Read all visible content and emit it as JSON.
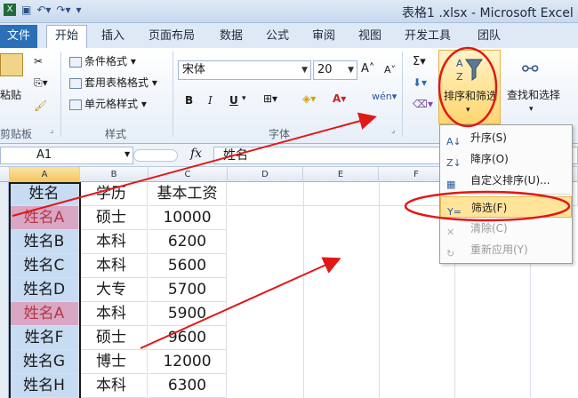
{
  "window": {
    "title": "表格1 .xlsx - Microsoft Excel"
  },
  "tabs": [
    "文件",
    "开始",
    "插入",
    "页面布局",
    "数据",
    "公式",
    "审阅",
    "视图",
    "开发工具",
    "团队"
  ],
  "ribbon": {
    "paste": "粘贴",
    "clipboard": "剪贴板",
    "styles": {
      "conditional": "条件格式",
      "table": "套用表格格式",
      "cell": "单元格样式",
      "label": "样式"
    },
    "font": {
      "name": "宋体",
      "size": "20",
      "label": "字体",
      "bold": "B",
      "italic": "I",
      "underline": "U"
    },
    "sort_filter": "排序和筛选",
    "find_select": "查找和选择"
  },
  "formula_bar": {
    "name_box": "A1",
    "fx": "fx",
    "value": "姓名"
  },
  "columns": [
    "A",
    "B",
    "C",
    "D",
    "E",
    "F"
  ],
  "table": {
    "headers": [
      "姓名",
      "学历",
      "基本工资"
    ],
    "rows": [
      [
        "姓名A",
        "硕士",
        "10000"
      ],
      [
        "姓名B",
        "本科",
        "6200"
      ],
      [
        "姓名C",
        "本科",
        "5600"
      ],
      [
        "姓名D",
        "大专",
        "5700"
      ],
      [
        "姓名A",
        "本科",
        "5900"
      ],
      [
        "姓名F",
        "硕士",
        "9600"
      ],
      [
        "姓名G",
        "博士",
        "12000"
      ],
      [
        "姓名H",
        "本科",
        "6300"
      ]
    ]
  },
  "dropdown": {
    "asc": "升序(S)",
    "desc": "降序(O)",
    "custom": "自定义排序(U)...",
    "filter": "筛选(F)",
    "clear": "清除(C)",
    "reapply": "重新应用(Y)"
  },
  "colors": {
    "accent": "#2a6fb7",
    "highlight": "#ffe49a",
    "annotation": "#e01818",
    "duplicate": "#d9a6c3"
  }
}
